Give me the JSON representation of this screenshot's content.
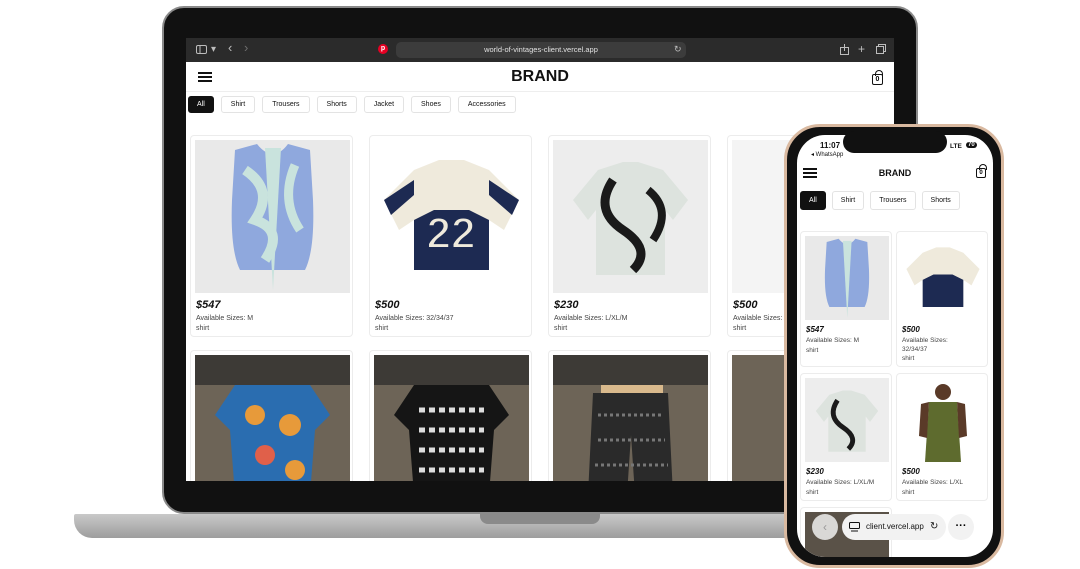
{
  "browser": {
    "url": "world-of-vintages-client.vercel.app",
    "sidebar_icon": "sidebar-icon",
    "back_icon": "‹",
    "forward_icon": "›",
    "reload_icon": "↻",
    "share_icon": "share-icon",
    "new_tab_icon": "+",
    "tabs_icon": "tabs-icon"
  },
  "site": {
    "brand": "BRAND",
    "cart_count": "0",
    "categories": [
      "All",
      "Shirt",
      "Trousers",
      "Shorts",
      "Jacket",
      "Shoes",
      "Accessories"
    ],
    "active_category": "All"
  },
  "products": [
    {
      "price": "$547",
      "sizes": "Available Sizes: M",
      "category": "shirt"
    },
    {
      "price": "$500",
      "sizes": "Available Sizes: 32/34/37",
      "category": "shirt"
    },
    {
      "price": "$230",
      "sizes": "Available Sizes: L/XL/M",
      "category": "shirt"
    },
    {
      "price": "$500",
      "sizes": "Available Sizes: L/XL",
      "category": "shirt"
    }
  ],
  "laptop_cut": {
    "sizes_partial": "Available Sizes: L/"
  },
  "phone": {
    "time": "11:07",
    "back_app": "◂ WhatsApp",
    "network": "LTE",
    "battery": "70",
    "brand": "BRAND",
    "cart_count": "0",
    "categories": [
      "All",
      "Shirt",
      "Trousers",
      "Shorts"
    ],
    "phone_sizes_2a": "Available Sizes:",
    "phone_sizes_2b": "32/34/37",
    "url_short": "client.vercel.app"
  },
  "colors": {
    "accent": "#111111",
    "browser_bar": "#2b2b2b",
    "phone_frame": "#d9b9a0"
  }
}
